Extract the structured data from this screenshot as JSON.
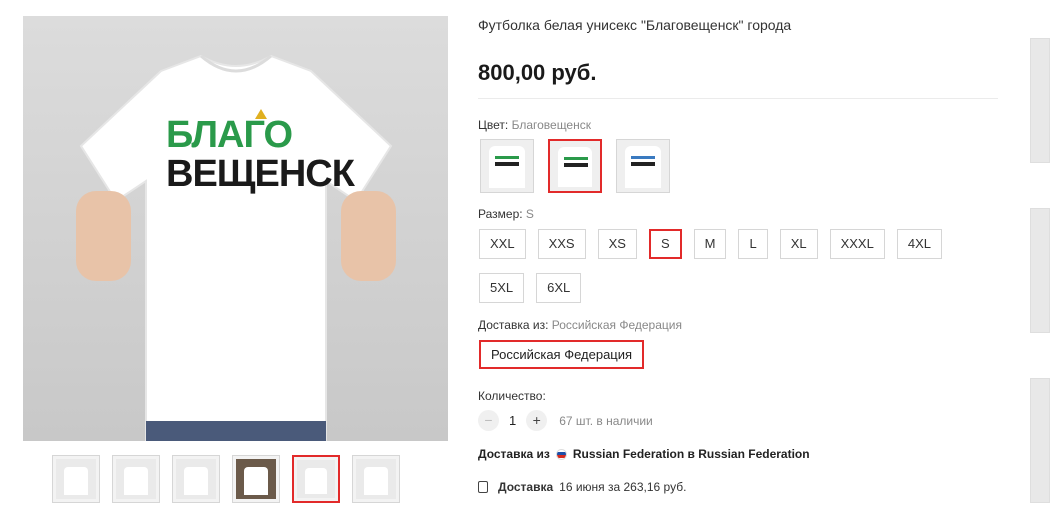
{
  "product": {
    "title": "Футболка белая унисекс \"Благовещенск\" города",
    "price": "800,00 руб.",
    "print_line1": "БЛАГО",
    "print_line2": "ВЕЩЕНСК"
  },
  "color": {
    "label": "Цвет:",
    "value": "Благовещенск",
    "selected_index": 1,
    "option_count": 3
  },
  "size": {
    "label": "Размер:",
    "value": "S",
    "options": [
      "XXL",
      "XXS",
      "XS",
      "S",
      "M",
      "L",
      "XL",
      "XXXL",
      "4XL",
      "5XL",
      "6XL"
    ],
    "selected": "S"
  },
  "shipping": {
    "label": "Доставка из:",
    "value": "Российская Федерация",
    "button": "Российская Федерация"
  },
  "quantity": {
    "label": "Количество:",
    "value": "1",
    "minus": "−",
    "plus": "+",
    "stock": "67 шт. в наличии"
  },
  "delivery": {
    "from_prefix": "Доставка из",
    "from_text": "Russian Federation в Russian Federation",
    "date_bold": "Доставка",
    "date_text": "16 июня за 263,16 руб."
  },
  "gallery": {
    "thumb_count": 6,
    "active_index": 4
  },
  "colors": {
    "accent": "#e22a2a",
    "print_green": "#2a9a4a"
  }
}
